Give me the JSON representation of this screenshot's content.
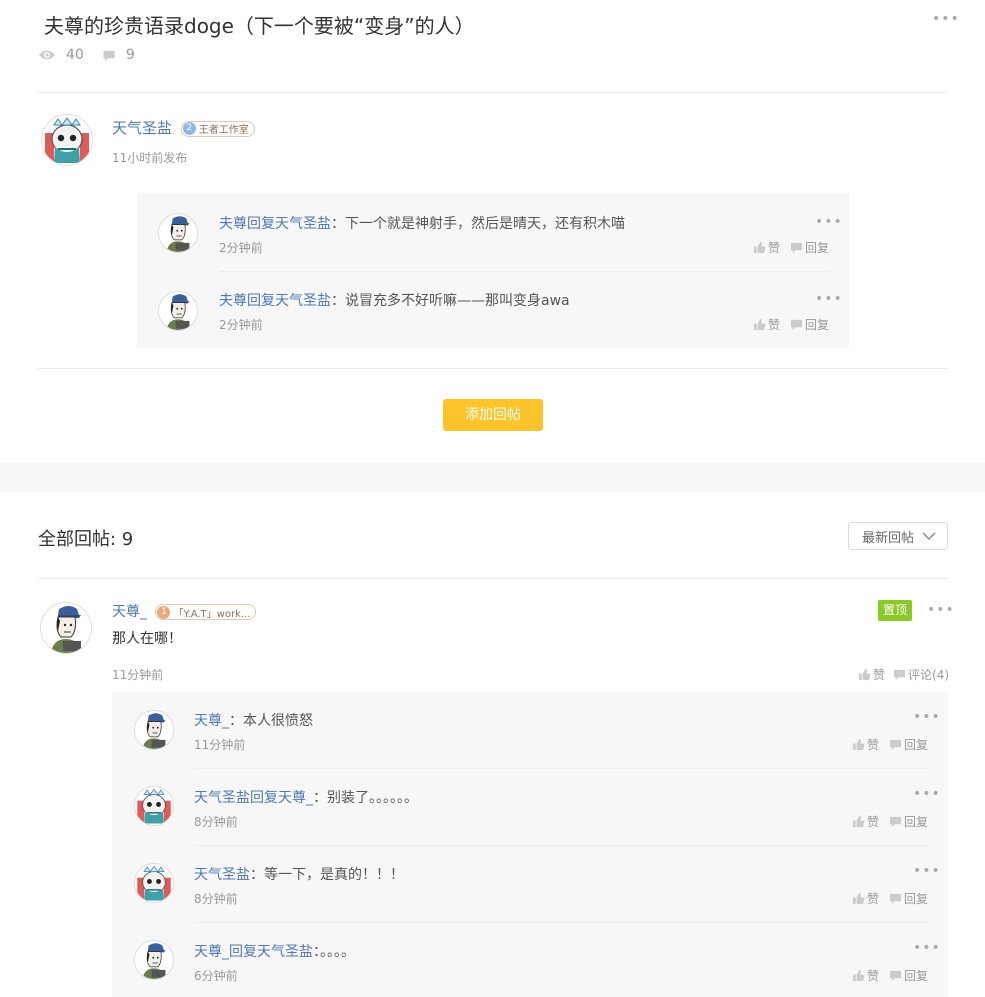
{
  "post": {
    "title": "夫尊的珍贵语录doge（下一个要被“变身”的人）",
    "views": "40",
    "comments": "9"
  },
  "author": {
    "name": "天气圣盐",
    "badge_level": "2",
    "badge_text": "王者工作室",
    "time": "11小时前发布"
  },
  "author_replies": [
    {
      "user": "夫尊",
      "reply_word": "回复",
      "target": "天气圣盐",
      "colon": "：",
      "text": "下一个就是神射手，然后是晴天，还有积木喵",
      "time": "2分钟前",
      "like": "赞",
      "reply": "回复"
    },
    {
      "user": "夫尊",
      "reply_word": "回复",
      "target": "天气圣盐",
      "colon": "：",
      "text": "说冒充多不好听嘛——那叫变身awa",
      "time": "2分钟前",
      "like": "赞",
      "reply": "回复"
    }
  ],
  "add_reply_label": "添加回帖",
  "all_replies_label": "全部回帖: 9",
  "sort": {
    "selected": "最新回帖"
  },
  "floor": {
    "name": "天尊_",
    "badge_level": "1",
    "badge_text": "「Y.A.T」work...",
    "pin_label": "置顶",
    "text": "那人在哪！",
    "time": "11分钟前",
    "like": "赞",
    "comment": "评论(4)"
  },
  "floor_replies": [
    {
      "user": "天尊_",
      "reply_word": "",
      "target": "",
      "colon": "：",
      "text": "本人很愤怒",
      "time": "11分钟前",
      "like": "赞",
      "reply": "回复"
    },
    {
      "user": "天气圣盐",
      "reply_word": "回复",
      "target": "天尊_",
      "colon": "：",
      "text": "别装了。。。。。。",
      "time": "8分钟前",
      "like": "赞",
      "reply": "回复"
    },
    {
      "user": "天气圣盐",
      "reply_word": "",
      "target": "",
      "colon": "：",
      "text": "等一下，是真的！！！",
      "time": "8分钟前",
      "like": "赞",
      "reply": "回复"
    },
    {
      "user": "天尊_",
      "reply_word": "回复",
      "target": "天气圣盐",
      "colon": "：",
      "text": "。。。。",
      "time": "6分钟前",
      "like": "赞",
      "reply": "回复"
    }
  ],
  "icons": {
    "views": "eye-icon",
    "comments": "comment-icon",
    "like": "thumbs-up-icon",
    "reply": "speech-bubble-icon",
    "more": "more-dots-icon",
    "sort": "chevron-down-icon"
  },
  "colors": {
    "link": "#4f78b4",
    "add_button": "#fcc42a",
    "pin_tag": "#8ac926",
    "reply_bg": "#f7f7f7"
  }
}
